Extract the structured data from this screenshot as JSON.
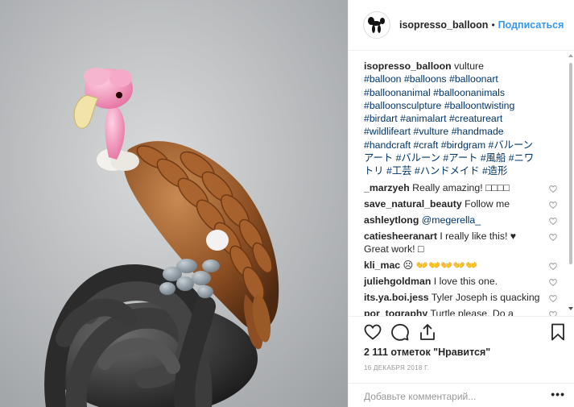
{
  "post_image": {
    "subject": "balloon vulture sculpture"
  },
  "header": {
    "username": "isopresso_balloon",
    "separator": "•",
    "follow_label": "Подписаться"
  },
  "caption": {
    "username": "isopresso_balloon",
    "text": " vulture",
    "hashtags": [
      "#balloon",
      "#balloons",
      "#balloonart",
      "#balloonanimal",
      "#balloonanimals",
      "#balloonsculpture",
      "#balloontwisting",
      "#birdart",
      "#animalart",
      "#creatureart",
      "#wildlifeart",
      "#vulture",
      "#handmade",
      "#handcraft",
      "#craft",
      "#birdgram",
      "#バルーンアート",
      "#バルーン",
      "#アート",
      "#風船",
      "#ニワトリ",
      "#工芸",
      "#ハンドメイド",
      "#造形"
    ]
  },
  "comments": [
    {
      "username": "_marzyeh",
      "text": " Really amazing! □□□□",
      "mention": ""
    },
    {
      "username": "save_natural_beauty",
      "text": " Follow me",
      "mention": ""
    },
    {
      "username": "ashleytlong",
      "text": " ",
      "mention": "@megerella_"
    },
    {
      "username": "catiesheeranart",
      "text": " I really like this! ♥ Great work! □",
      "mention": ""
    },
    {
      "username": "kli_mac",
      "text": " ☹ 👐👐👐👐👐",
      "mention": ""
    },
    {
      "username": "juliehgoldman",
      "text": " I love this one.",
      "mention": ""
    },
    {
      "username": "its.ya.boi.jess",
      "text": " Tyler Joseph is quacking",
      "mention": ""
    },
    {
      "username": "por_tography",
      "text": " Turtle please. Do a turtle.",
      "mention": ""
    }
  ],
  "actions": {
    "like_icon": "heart-outline-icon",
    "comment_icon": "comment-bubble-icon",
    "share_icon": "share-icon",
    "save_icon": "bookmark-icon"
  },
  "likes": {
    "count": "2 111 отметок",
    "text": " \"Нравится\""
  },
  "date": "16 декабря 2018 г.",
  "comment_input": {
    "placeholder": "Добавьте комментарий...",
    "more_label": "•••"
  },
  "colors": {
    "link": "#003569",
    "follow": "#3897f0",
    "border": "#efefef",
    "muted": "#999999"
  }
}
